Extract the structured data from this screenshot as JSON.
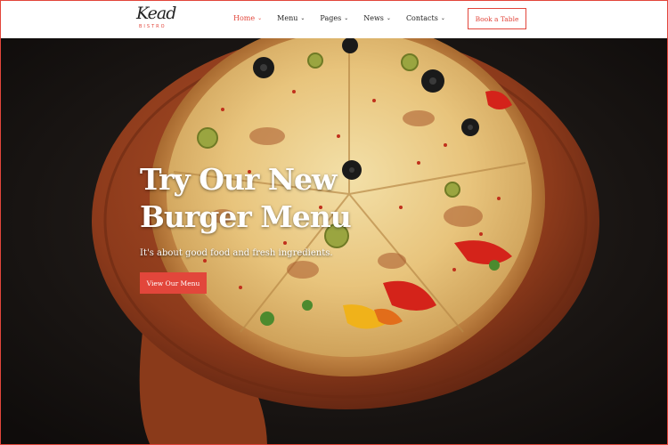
{
  "brand": {
    "logo_script": "Kead",
    "logo_sub": "BISTRO"
  },
  "nav": {
    "items": [
      {
        "label": "Home",
        "active": true
      },
      {
        "label": "Menu",
        "active": false
      },
      {
        "label": "Pages",
        "active": false
      },
      {
        "label": "News",
        "active": false
      },
      {
        "label": "Contacts",
        "active": false
      }
    ]
  },
  "header": {
    "cta_label": "Book a Table"
  },
  "hero": {
    "title": "Try Our New Burger Menu",
    "subtitle": "It's about good food and fresh ingredients.",
    "button_label": "View Our Menu"
  },
  "colors": {
    "accent": "#e2463b",
    "header_bg": "#ffffff",
    "hero_bg": "#1a1614"
  }
}
